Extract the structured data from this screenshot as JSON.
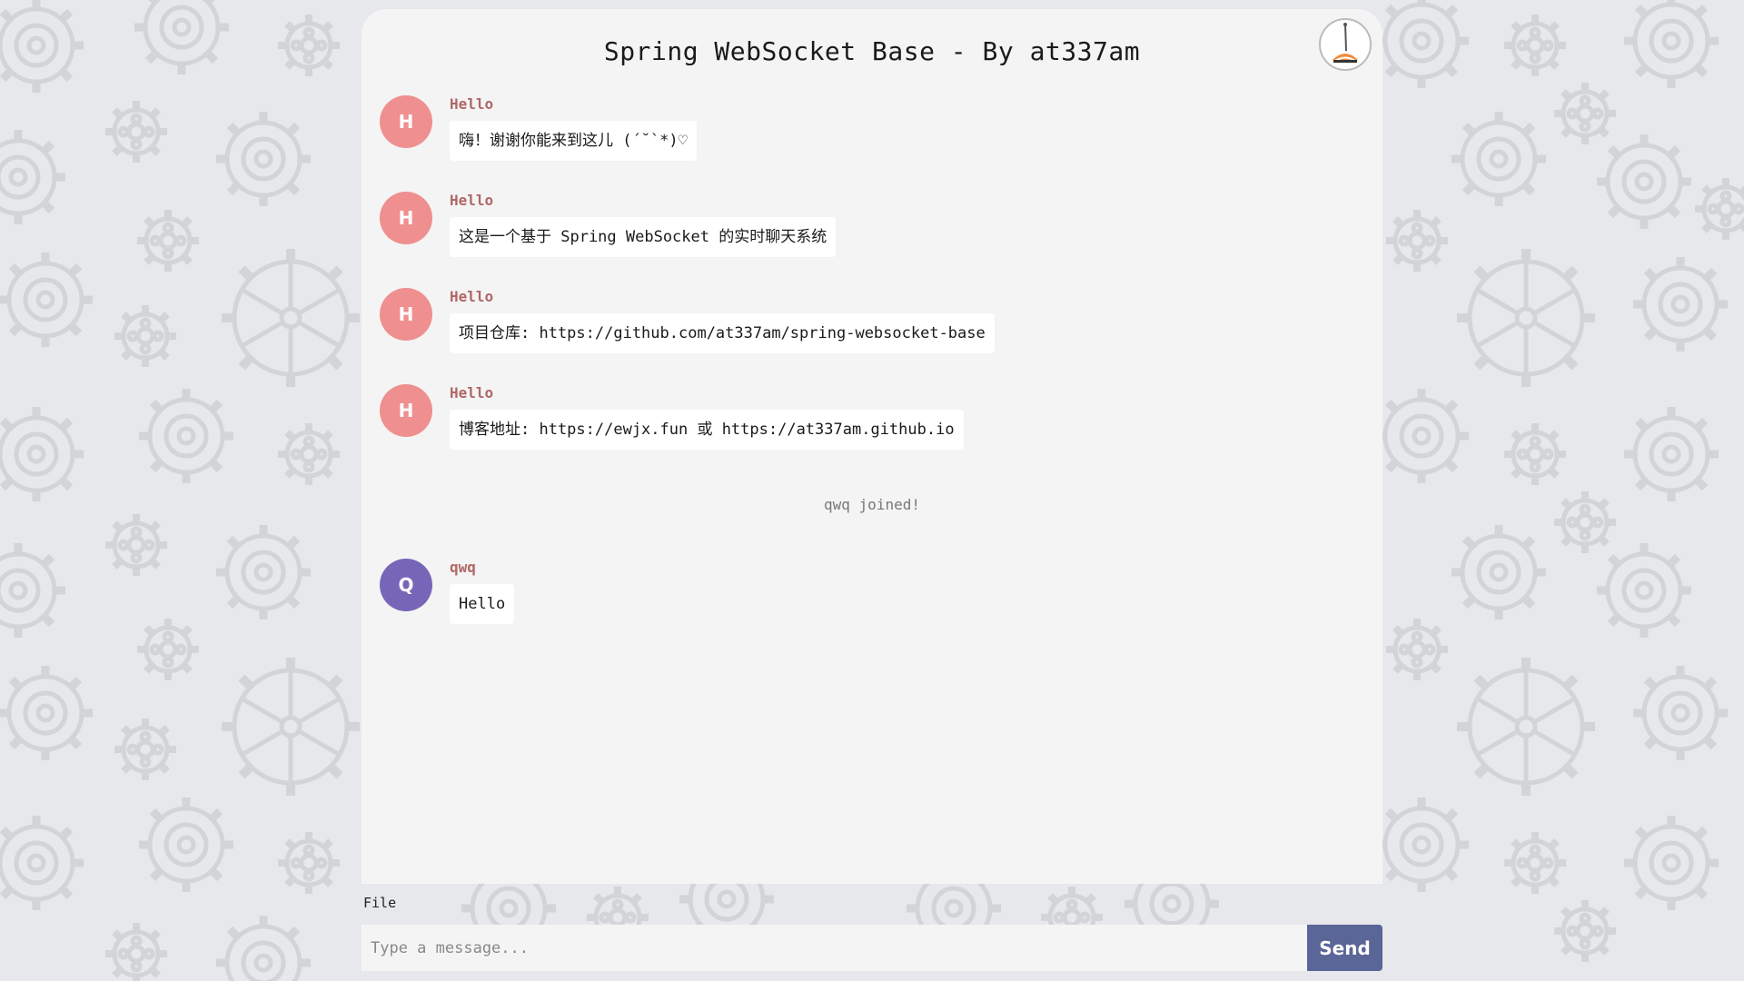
{
  "header": {
    "title": "Spring WebSocket Base - By at337am",
    "avatar_icon": "user-avatar-illustration-icon"
  },
  "colors": {
    "background": "#e6e8eb",
    "panel": "#f4f4f4",
    "gear_stroke": "#d2d4d8",
    "avatar_h": "#ef8f8f",
    "avatar_q": "#7766b8",
    "sender_name": "#b06666",
    "send_button": "#5a6598"
  },
  "messages": [
    {
      "avatar_letter": "H",
      "sender": "Hello",
      "text": "嗨！谢谢你能来到这儿 (´˘`*)♡"
    },
    {
      "avatar_letter": "H",
      "sender": "Hello",
      "text": "这是一个基于 Spring WebSocket 的实时聊天系统"
    },
    {
      "avatar_letter": "H",
      "sender": "Hello",
      "text": "项目仓库: https://github.com/at337am/spring-websocket-base"
    },
    {
      "avatar_letter": "H",
      "sender": "Hello",
      "text": "博客地址: https://ewjx.fun 或 https://at337am.github.io"
    }
  ],
  "system_message": "qwq joined!",
  "last_message": {
    "avatar_letter": "Q",
    "sender": "qwq",
    "text": "Hello"
  },
  "composer": {
    "file_label": "File",
    "placeholder": "Type a message...",
    "send_label": "Send"
  }
}
